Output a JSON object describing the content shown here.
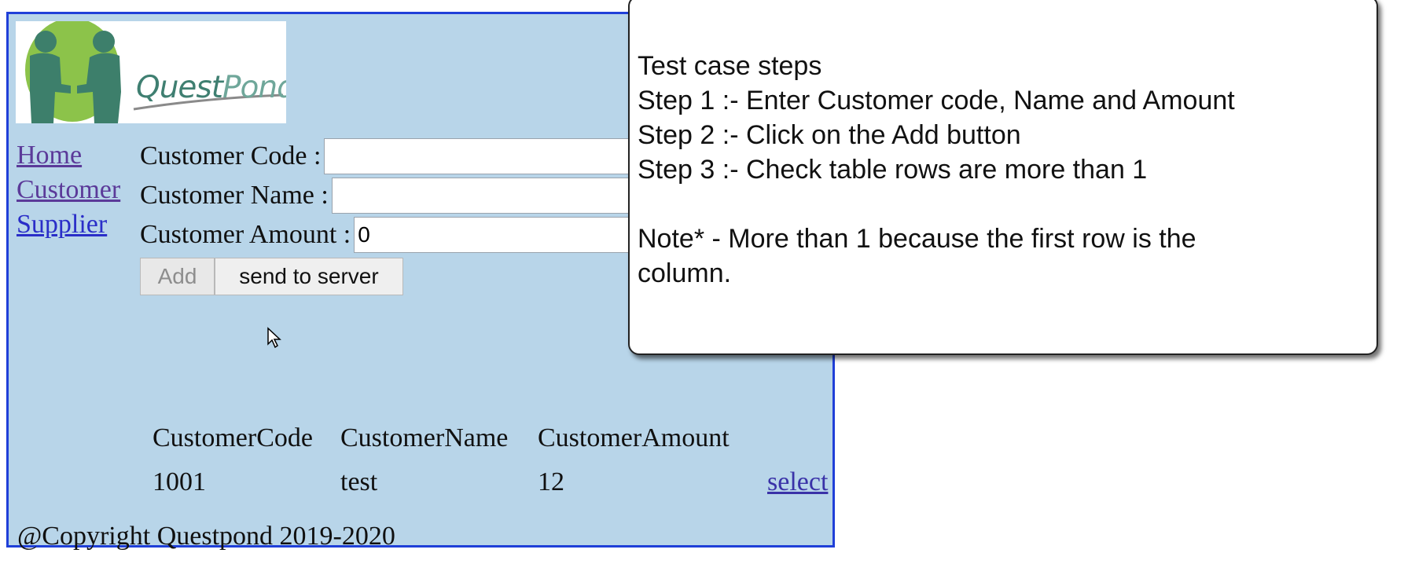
{
  "logo": {
    "text_a": "Quest",
    "text_b": "Pond"
  },
  "nav": {
    "home": "Home",
    "customer": "Customer",
    "supplier": "Supplier"
  },
  "form": {
    "code_label": "Customer Code :",
    "code_value": "",
    "name_label": "Customer Name :",
    "name_value": "",
    "amount_label": "Customer Amount :",
    "amount_value": "0"
  },
  "buttons": {
    "add": "Add",
    "send": "send to server"
  },
  "table": {
    "headers": [
      "CustomerCode",
      "CustomerName",
      "CustomerAmount"
    ],
    "rows": [
      {
        "code": "1001",
        "name": "test",
        "amount": "12",
        "action": "select"
      }
    ]
  },
  "footer": "@Copyright Questpond 2019-2020",
  "callout": {
    "title": "Test case steps",
    "step1": "Step 1 :- Enter Customer code, Name and Amount",
    "step2": "Step 2 :- Click on the Add button",
    "step3": "Step 3 :- Check table rows are more than 1",
    "note1": "Note* - More than 1 because the first row is the",
    "note2": "column."
  },
  "colors": {
    "page_bg": "#b8d5e9",
    "frame_border": "#1f3fd8",
    "link": "#2a2ec8"
  }
}
